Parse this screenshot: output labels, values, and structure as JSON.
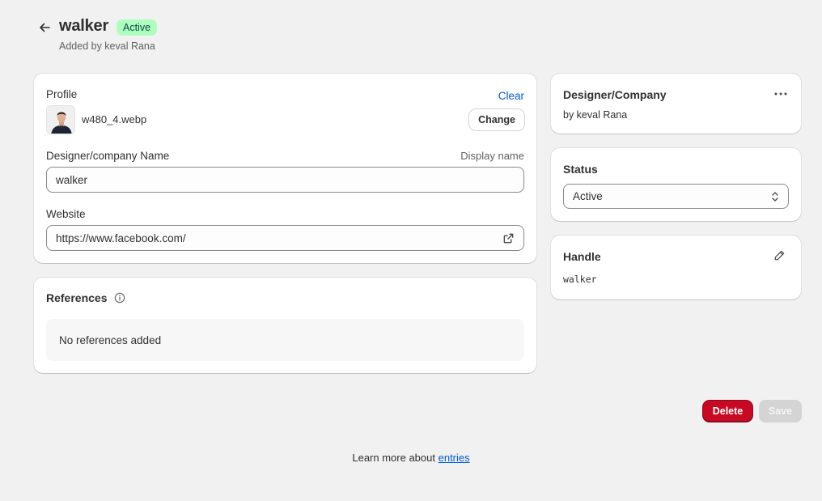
{
  "header": {
    "title": "walker",
    "status_badge": "Active",
    "subtitle": "Added by keval Rana"
  },
  "profile_card": {
    "profile_label": "Profile",
    "clear_label": "Clear",
    "file_name": "w480_4.webp",
    "change_label": "Change",
    "name_label": "Designer/company Name",
    "display_name_hint": "Display name",
    "name_value": "walker",
    "website_label": "Website",
    "website_value": "https://www.facebook.com/"
  },
  "references_card": {
    "title": "References",
    "empty_text": "No references added"
  },
  "designer_card": {
    "title": "Designer/Company",
    "subtitle": "by keval Rana"
  },
  "status_card": {
    "title": "Status",
    "selected": "Active"
  },
  "handle_card": {
    "title": "Handle",
    "value": "walker"
  },
  "actions": {
    "delete_label": "Delete",
    "save_label": "Save"
  },
  "footer": {
    "text": "Learn more about",
    "link_text": "entries"
  },
  "colors": {
    "accent_link": "#005bd3",
    "badge_bg": "#affebf",
    "delete_bg": "#c70a24",
    "page_bg": "#f1f1f1"
  }
}
